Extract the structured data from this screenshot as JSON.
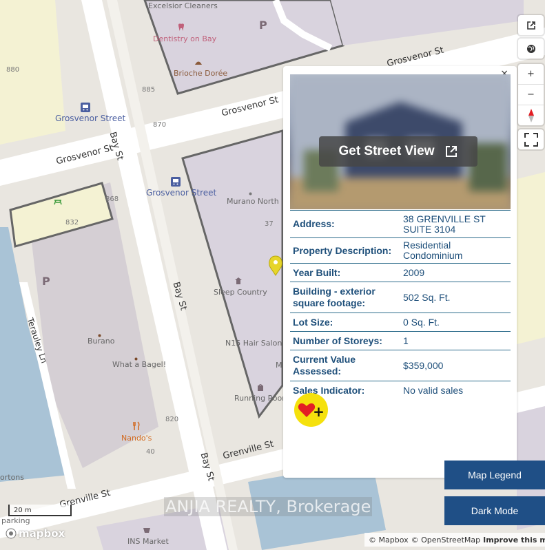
{
  "map": {
    "streets": {
      "bay_st_1": "Bay St",
      "bay_st_2": "Bay St",
      "bay_st_3": "Bay St",
      "grosvenor_st_1": "Grosvenor St",
      "grosvenor_st_2": "Grosvenor St",
      "grosvenor_st_3": "Grosvenor St",
      "grenville_st_1": "Grenville St",
      "grenville_st_2": "Grenville St",
      "terauley_ln": "Terauley Ln"
    },
    "pois": {
      "excelsior": "Excelsior Cleaners",
      "dentistry": "Dentistry on Bay",
      "brioche": "Brioche Dorée",
      "murano": "Murano North",
      "sleep_country": "Sleep Country",
      "n15": "N15 Hair Salon",
      "running_room": "Running Room",
      "burano": "Burano",
      "bagel": "What a Bagel!",
      "nandos": "Nando's",
      "ins": "INS Market",
      "me": "Me",
      "ortons": "ortons",
      "parking": "parking"
    },
    "transit": {
      "grosvenor_street_1": "Grosvenor Street",
      "grosvenor_street_2": "Grosvenor Street"
    },
    "numbers": {
      "n880": "880",
      "n885": "885",
      "n870": "870",
      "n868": "868",
      "n832": "832",
      "n37": "37",
      "n820": "820",
      "n40": "40"
    },
    "parking_symbol": "P"
  },
  "controls": {
    "zoom_in": "+",
    "zoom_out": "−"
  },
  "popup": {
    "close": "×",
    "street_view_label": "Get Street View",
    "rows": [
      {
        "label": "Address:",
        "value": "38 GRENVILLE ST SUITE 3104"
      },
      {
        "label": "Property Description:",
        "value": "Residential Condominium"
      },
      {
        "label": "Year Built:",
        "value": "2009"
      },
      {
        "label": "Building - exterior square footage:",
        "value": "502 Sq. Ft."
      },
      {
        "label": "Lot Size:",
        "value": "0 Sq. Ft."
      },
      {
        "label": "Number of Storeys:",
        "value": "1"
      },
      {
        "label": "Current Value Assessed:",
        "value": "$359,000"
      },
      {
        "label": "Sales Indicator:",
        "value": "No valid sales"
      }
    ],
    "favorite_plus": "+"
  },
  "buttons": {
    "map_legend": "Map Legend",
    "dark_mode": "Dark Mode"
  },
  "watermark": "ANJIA REALTY, Brokerage",
  "scale": "20 m",
  "logo": "mapbox",
  "attribution": {
    "mapbox": "© Mapbox",
    "osm": "© OpenStreetMap",
    "improve": "Improve this map"
  },
  "colors": {
    "building": "#d9d3de",
    "park": "#f4f2d3",
    "water": "#a9c3d6",
    "road": "#ffffff",
    "popup_text": "#1e4f7a",
    "button": "#1f4f86",
    "favorite": "#f5e10d",
    "heart": "#e31e24",
    "marker": "#e6d52a"
  }
}
